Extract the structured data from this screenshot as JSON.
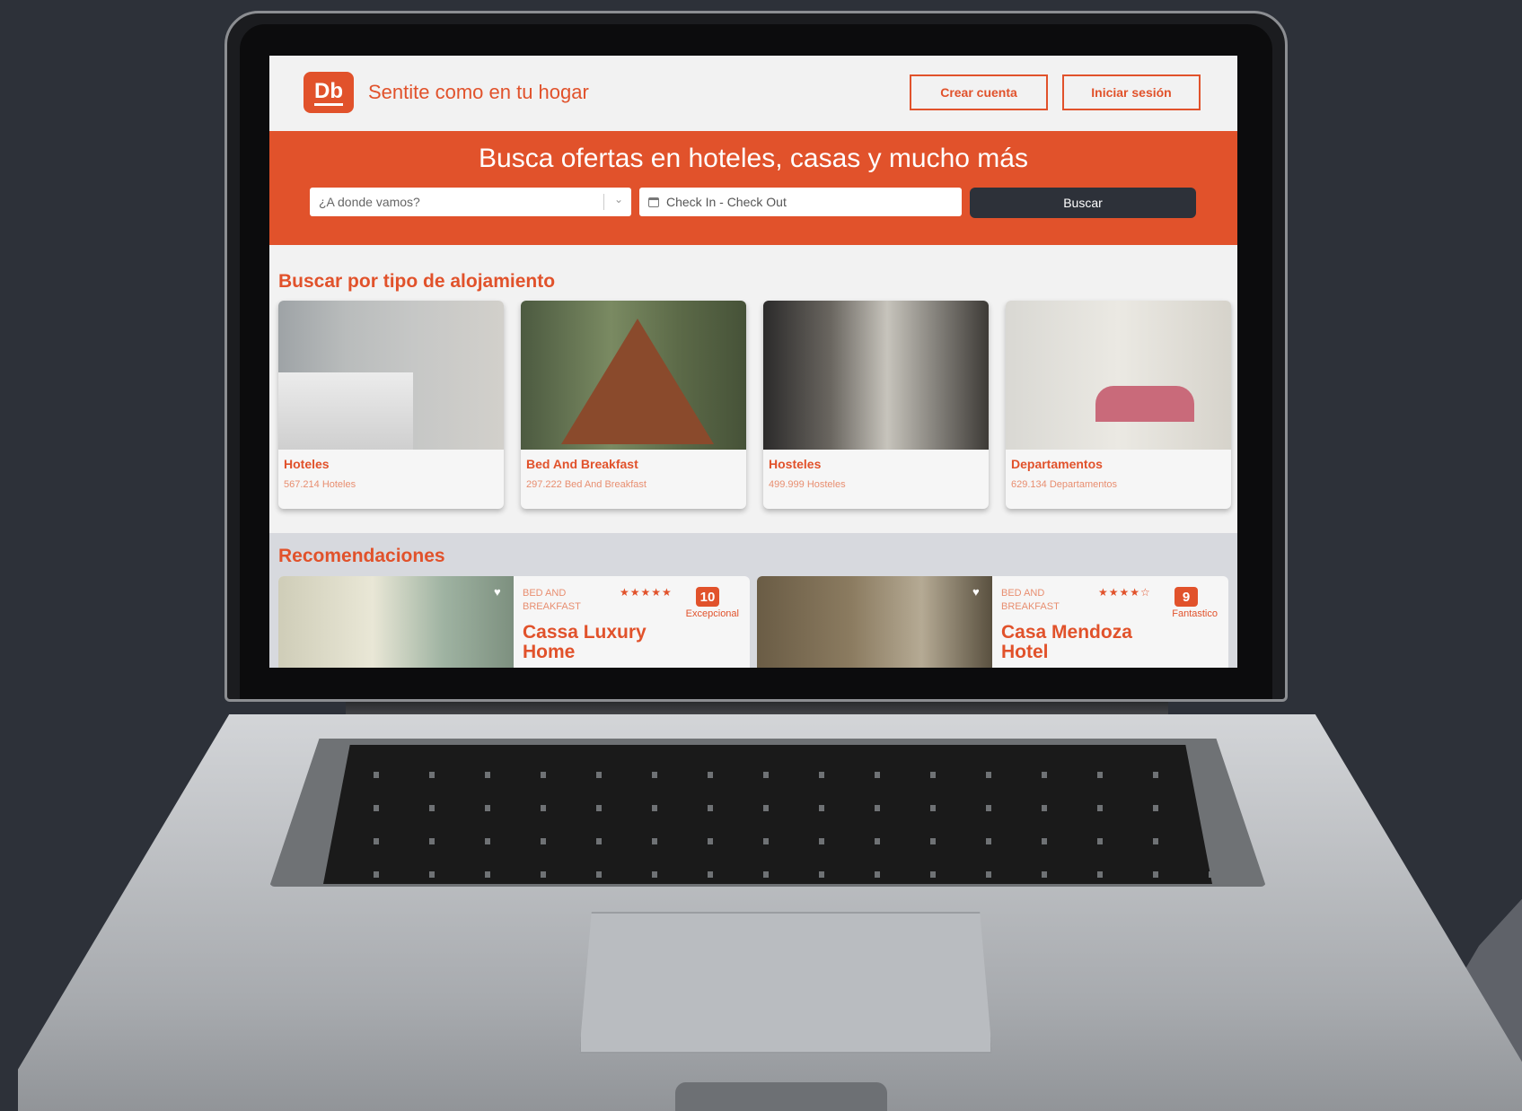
{
  "header": {
    "logo_text": "Db",
    "tagline": "Sentite como en tu hogar",
    "create_account_label": "Crear cuenta",
    "login_label": "Iniciar sesión"
  },
  "hero": {
    "title": "Busca ofertas en hoteles, casas y mucho más",
    "destination_placeholder": "¿A donde vamos?",
    "dates_placeholder": "Check In - Check Out",
    "search_label": "Buscar"
  },
  "categories": {
    "title": "Buscar por tipo de alojamiento",
    "items": [
      {
        "name": "Hoteles",
        "count": "567.214 Hoteles"
      },
      {
        "name": "Bed And Breakfast",
        "count": "297.222 Bed And Breakfast"
      },
      {
        "name": "Hosteles",
        "count": "499.999 Hosteles"
      },
      {
        "name": "Departamentos",
        "count": "629.134 Departamentos"
      }
    ]
  },
  "recommendations": {
    "title": "Recomendaciones",
    "items": [
      {
        "type": "BED AND BREAKFAST",
        "stars": "★★★★★",
        "score": "10",
        "score_label": "Excepcional",
        "name": "Cassa Luxury Home"
      },
      {
        "type": "BED AND BREAKFAST",
        "stars": "★★★★☆",
        "score": "9",
        "score_label": "Fantastico",
        "name": "Casa Mendoza Hotel"
      }
    ]
  },
  "colors": {
    "brand": "#e1522b",
    "dark": "#2d3139"
  }
}
